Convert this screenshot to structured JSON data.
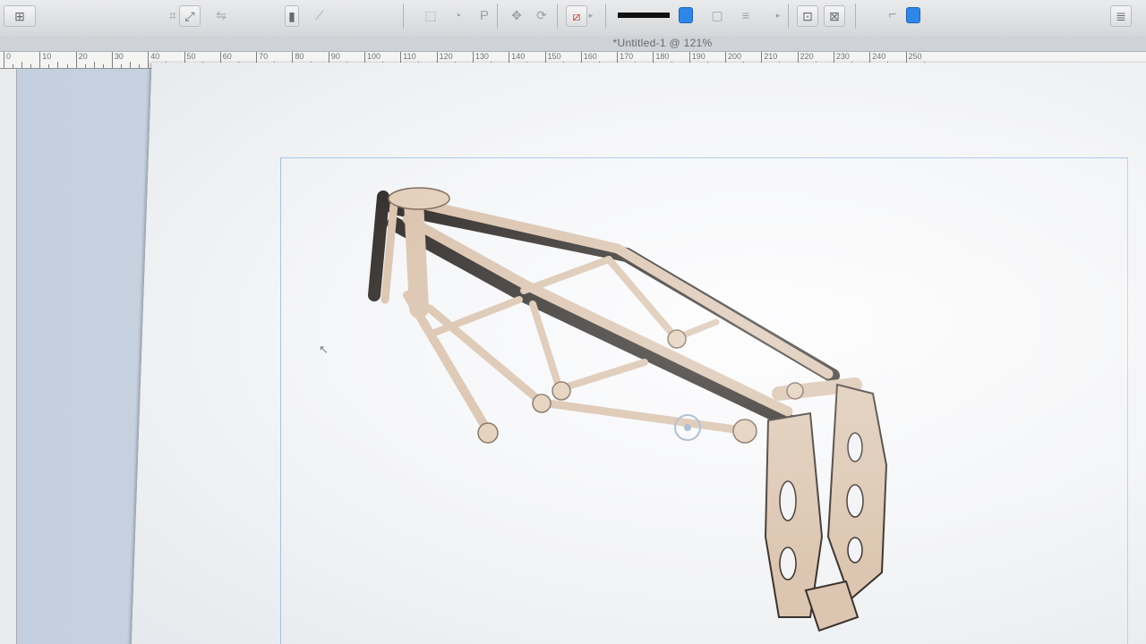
{
  "window": {
    "document_title": "*Untitled-1 @ 121%"
  },
  "control_bar": {
    "tools": [
      {
        "name": "align-icon",
        "glyph": "⌗"
      },
      {
        "name": "transform-icon",
        "glyph": "⤢"
      },
      {
        "name": "text-tool-icon",
        "glyph": "P"
      },
      {
        "name": "move-icon",
        "glyph": "✥"
      },
      {
        "name": "rotate-icon",
        "glyph": "⟳"
      },
      {
        "name": "no-fill-icon",
        "glyph": "⧄"
      },
      {
        "name": "stroke-weight-icon",
        "glyph": "≡"
      },
      {
        "name": "frame-icon",
        "glyph": "▢"
      },
      {
        "name": "corner-icon",
        "glyph": "⌐"
      }
    ],
    "accent_color": "#2e86e8"
  },
  "ruler": {
    "labels": [
      "0",
      "10",
      "20",
      "30",
      "40",
      "50",
      "60",
      "70",
      "80",
      "90",
      "100",
      "110",
      "120",
      "130",
      "140",
      "150",
      "160",
      "170",
      "180",
      "190",
      "200",
      "210",
      "220",
      "230",
      "240",
      "250"
    ]
  },
  "canvas": {
    "drawing": "motorcycle-frame",
    "frame_color": "#d9c1ab",
    "shadow_color": "#2b2623"
  }
}
